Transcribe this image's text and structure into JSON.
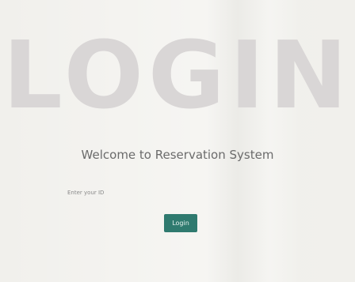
{
  "hero": {
    "title": "LOGIN"
  },
  "welcome": {
    "text": "Welcome to Reservation System"
  },
  "form": {
    "id_label": "Enter your ID",
    "id_value": "",
    "login_button_label": "Login"
  },
  "colors": {
    "background": "#f1f0ec",
    "hero_text": "#d9d6d6",
    "welcome_text": "#6b6b6b",
    "button_bg": "#2f7a6f",
    "button_text": "#e6f2ef"
  }
}
